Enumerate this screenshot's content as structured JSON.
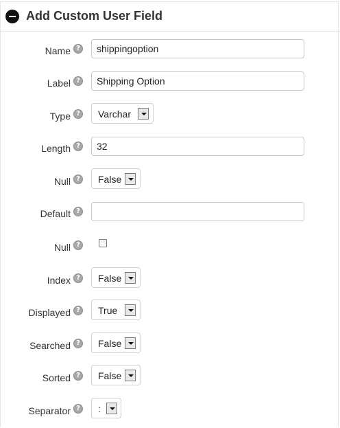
{
  "panel": {
    "title": "Add Custom User Field",
    "help_glyph": "?"
  },
  "fields": {
    "name": {
      "label": "Name",
      "value": "shippingoption"
    },
    "label": {
      "label": "Label",
      "value": "Shipping Option"
    },
    "type": {
      "label": "Type",
      "selected": "Varchar"
    },
    "length": {
      "label": "Length",
      "value": "32"
    },
    "null_select": {
      "label": "Null",
      "selected": "False"
    },
    "default": {
      "label": "Default",
      "value": ""
    },
    "null_checkbox": {
      "label": "Null",
      "checked": false
    },
    "index": {
      "label": "Index",
      "selected": "False"
    },
    "displayed": {
      "label": "Displayed",
      "selected": "True"
    },
    "searched": {
      "label": "Searched",
      "selected": "False"
    },
    "sorted": {
      "label": "Sorted",
      "selected": "False"
    },
    "separator": {
      "label": "Separator",
      "selected": ":"
    }
  }
}
